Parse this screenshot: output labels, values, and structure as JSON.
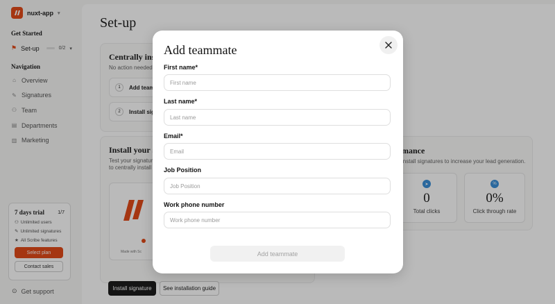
{
  "sidebar": {
    "workspace": "nuxt-app",
    "get_started": "Get Started",
    "setup": {
      "label": "Set-up",
      "progress": "0/2"
    },
    "navigation_heading": "Navigation",
    "nav_items": [
      {
        "label": "Overview",
        "icon": "home-icon"
      },
      {
        "label": "Signatures",
        "icon": "pen-icon"
      },
      {
        "label": "Team",
        "icon": "team-icon"
      },
      {
        "label": "Departments",
        "icon": "departments-icon"
      },
      {
        "label": "Marketing",
        "icon": "chart-icon"
      }
    ],
    "trial": {
      "title": "7 days trial",
      "days": "1/7",
      "features": [
        "Unlimited users",
        "Unlimited signatures",
        "All Scribe features"
      ],
      "select_plan": "Select plan",
      "contact_sales": "Contact sales"
    },
    "support": "Get support"
  },
  "main": {
    "title": "Set-up",
    "centrally": {
      "title": "Centrally inst",
      "sub": "No action needed",
      "steps": [
        {
          "n": "1",
          "label": "Add teamm"
        },
        {
          "n": "2",
          "label": "Install signa"
        }
      ]
    },
    "install": {
      "title": "Install your si",
      "sub_line1": "Test your signatur",
      "sub_line2": "to centrally install",
      "made_with": "Made with Sc"
    },
    "performance": {
      "title": "mance",
      "sub": "install signatures to increase your lead generation.",
      "stats": [
        {
          "value": "0",
          "label": "Total clicks"
        },
        {
          "value": "0%",
          "label": "Click through rate"
        }
      ]
    },
    "install_button": "Install signature",
    "guide_button": "See installation guide"
  },
  "modal": {
    "title": "Add teammate",
    "fields": [
      {
        "label": "First name*",
        "placeholder": "First name"
      },
      {
        "label": "Last name*",
        "placeholder": "Last name"
      },
      {
        "label": "Email*",
        "placeholder": "Email"
      },
      {
        "label": "Job Position",
        "placeholder": "Job Position"
      },
      {
        "label": "Work phone number",
        "placeholder": "Work phone number"
      }
    ],
    "submit": "Add teammate"
  },
  "colors": {
    "accent": "#e34a1a",
    "dark_button": "#1e1e1e",
    "stat_icon": "#3a8fd8"
  }
}
